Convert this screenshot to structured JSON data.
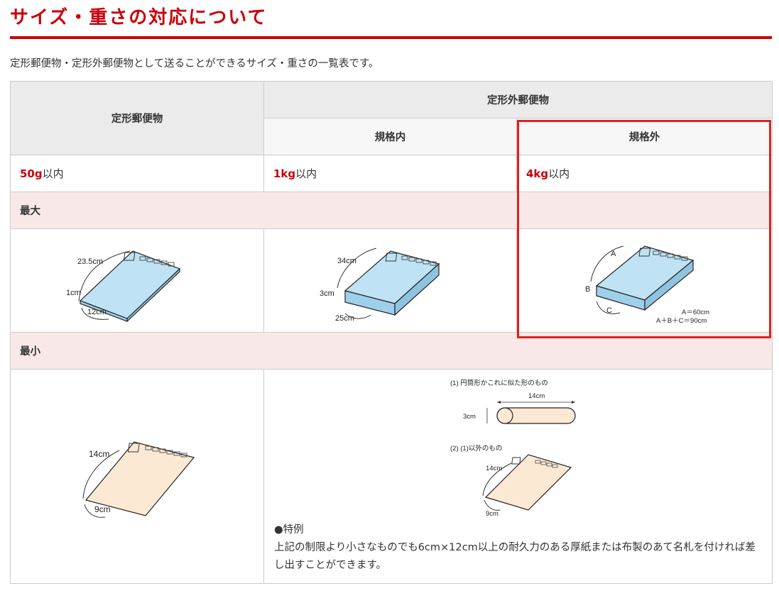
{
  "page": {
    "title": "サイズ・重さの対応について",
    "intro": "定形郵便物・定形外郵便物として送ることができるサイズ・重さの一覧表です。"
  },
  "table": {
    "col_teikei": "定形郵便物",
    "col_teikeigai": "定形外郵便物",
    "sub_kikakunai": "規格内",
    "sub_kikakugai": "規格外",
    "weights": [
      {
        "num": "50g",
        "suffix": "以内"
      },
      {
        "num": "1kg",
        "suffix": "以内"
      },
      {
        "num": "4kg",
        "suffix": "以内"
      }
    ],
    "row_max": "最大",
    "row_min": "最小"
  },
  "figures": {
    "teikei_max": {
      "w": "23.5cm",
      "t": "1cm",
      "h": "12cm"
    },
    "nai_max": {
      "w": "34cm",
      "t": "3cm",
      "h": "25cm"
    },
    "gai_max": {
      "a": "A",
      "b": "B",
      "c": "C",
      "eq1": "A＝60cm",
      "eq2": "A＋B＋C＝90cm"
    },
    "teikei_min": {
      "w": "14cm",
      "h": "9cm"
    },
    "nai_min": {
      "cyl_caption": "(1) 円筒形かこれに似た形のもの",
      "cyl_len": "14cm",
      "cyl_dia": "3cm",
      "other_caption": "(2)  (1)以外のもの",
      "w": "14cm",
      "h": "9cm"
    }
  },
  "tokurei": {
    "head": "●特例",
    "body": "上記の制限より小さなものでも6cm×12cm以上の耐久力のある厚紙または布製のあて名札を付ければ差し出すことができます。"
  },
  "colors": {
    "accent": "#c8000a",
    "highlight": "#e02020",
    "envelope_blue": "#bfe3f4",
    "envelope_peach": "#fce9d4",
    "pink_row": "#f8e9e8"
  }
}
